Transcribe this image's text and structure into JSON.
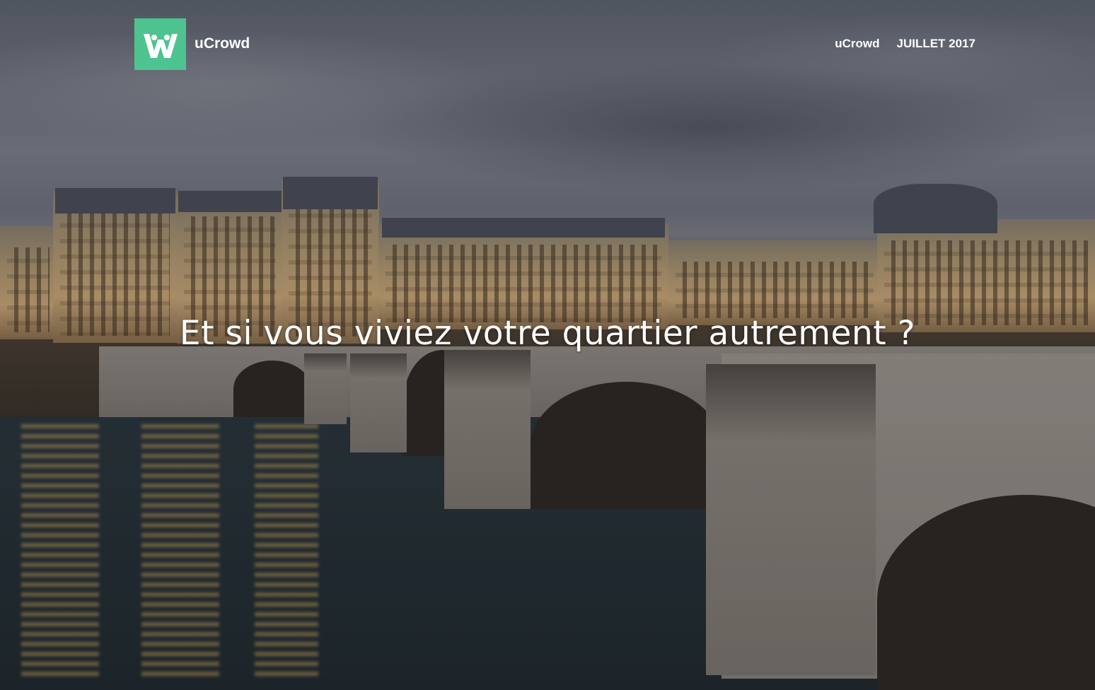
{
  "header": {
    "brand_name": "uCrowd",
    "logo_icon": "ucrowd-w-people-icon",
    "logo_color": "#4dc48f",
    "nav": [
      {
        "label": "uCrowd"
      },
      {
        "label": "JUILLET 2017"
      }
    ]
  },
  "hero": {
    "headline": "Et si vous viviez votre quartier autrement ?"
  }
}
